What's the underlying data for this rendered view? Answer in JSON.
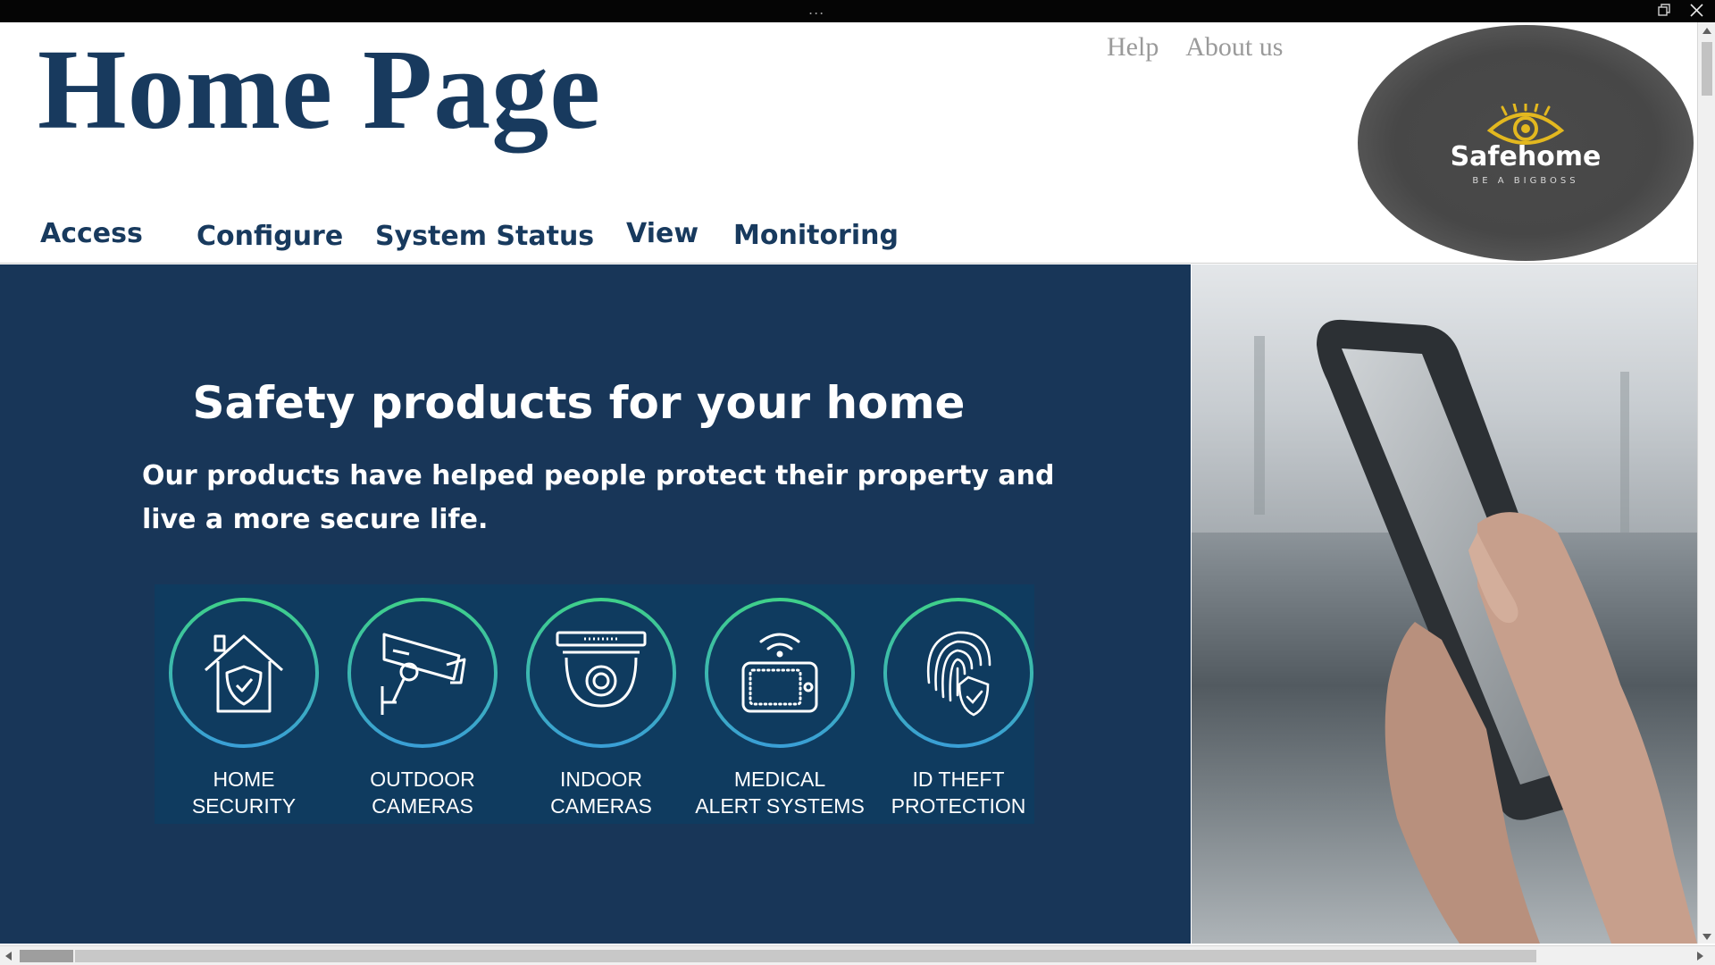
{
  "window": {
    "menu_dots": "...",
    "restore_icon": "restore-icon",
    "close_icon": "close-icon"
  },
  "header": {
    "title": "Home Page",
    "links": [
      "Help",
      "About us"
    ],
    "logo": {
      "name": "Safehome",
      "tagline": "BE A BIGBOSS",
      "icon": "eye-icon",
      "accent": "#e3b81f"
    }
  },
  "nav": {
    "items": [
      "Access",
      "Configure",
      "System Status",
      "View",
      "Monitoring"
    ]
  },
  "hero": {
    "title": "Safety products for your home",
    "subtitle": "Our products have helped people protect their property and live a more secure life.",
    "background": "#183658"
  },
  "products": [
    {
      "line1": "HOME",
      "line2": "SECURITY",
      "icon": "house-shield-icon"
    },
    {
      "line1": "OUTDOOR",
      "line2": "CAMERAS",
      "icon": "security-camera-icon"
    },
    {
      "line1": "INDOOR",
      "line2": "CAMERAS",
      "icon": "dome-camera-icon"
    },
    {
      "line1": "MEDICAL",
      "line2": "ALERT SYSTEMS",
      "icon": "alert-device-icon"
    },
    {
      "line1": "ID THEFT",
      "line2": "PROTECTION",
      "icon": "fingerprint-shield-icon"
    }
  ],
  "colors": {
    "primary": "#183a5e",
    "ring_start": "#3fd08a",
    "ring_end": "#3a9fd6"
  }
}
